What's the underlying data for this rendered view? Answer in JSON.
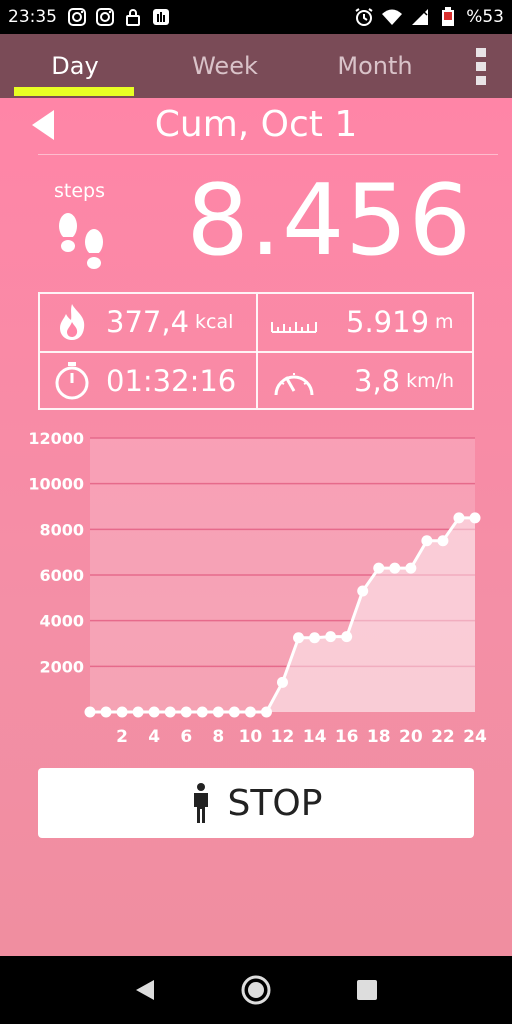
{
  "status_bar": {
    "time": "23:35",
    "battery": "%53",
    "left_icons": [
      "instagram-icon",
      "instagram-icon",
      "lock-icon",
      "hand-icon"
    ],
    "right_icons": [
      "alarm-icon",
      "wifi-icon",
      "signal-icon",
      "battery-icon"
    ]
  },
  "tabs": [
    {
      "label": "Day",
      "active": true
    },
    {
      "label": "Week",
      "active": false
    },
    {
      "label": "Month",
      "active": false
    }
  ],
  "date": "Cum, Oct 1",
  "steps": {
    "label": "steps",
    "value": "8.456"
  },
  "stats": {
    "calories": {
      "value": "377,4",
      "unit": "kcal",
      "icon": "fire-icon"
    },
    "distance": {
      "value": "5.919",
      "unit": "m",
      "icon": "ruler-icon"
    },
    "duration": {
      "value": "01:32:16",
      "icon": "stopwatch-icon"
    },
    "speed": {
      "value": "3,8",
      "unit": "km/h",
      "icon": "speedometer-icon"
    }
  },
  "chart_data": {
    "type": "area",
    "x": [
      0,
      1,
      2,
      3,
      4,
      5,
      6,
      7,
      8,
      9,
      10,
      11,
      12,
      13,
      14,
      15,
      16,
      17,
      18,
      19,
      20,
      21,
      22,
      23,
      24
    ],
    "values": [
      0,
      0,
      0,
      0,
      0,
      0,
      0,
      0,
      0,
      0,
      0,
      0,
      1300,
      3250,
      3250,
      3300,
      3300,
      5300,
      6300,
      6300,
      6300,
      7500,
      7500,
      8500,
      8500
    ],
    "x_ticks": [
      "2",
      "4",
      "6",
      "8",
      "10",
      "12",
      "14",
      "16",
      "18",
      "20",
      "22",
      "24"
    ],
    "y_ticks": [
      "2000",
      "4000",
      "6000",
      "8000",
      "10000",
      "12000"
    ],
    "ylim": [
      0,
      12000
    ],
    "xlim": [
      0,
      24
    ],
    "grid": true,
    "colors": {
      "line": "#ffffff",
      "fill": "#f7dde3",
      "grid": "#e66a8b"
    }
  },
  "stop_button": {
    "label": "STOP",
    "icon": "person-icon"
  },
  "colors": {
    "accent": "#e8ff24",
    "tabbar": "#7a4b57",
    "background": "#f28fa6"
  }
}
